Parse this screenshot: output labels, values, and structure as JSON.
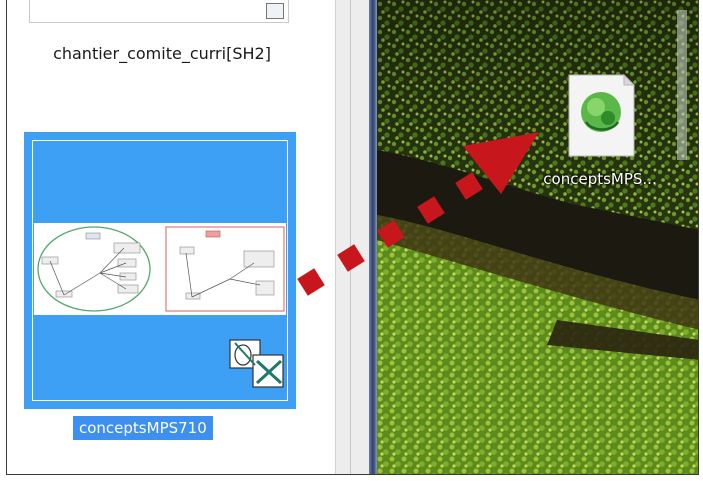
{
  "browser": {
    "previous_item_label": "chantier_comite_curri[SH2]",
    "selected_item_label": "conceptsMPS710"
  },
  "desktop": {
    "icon_label": "conceptsMPS..."
  },
  "colors": {
    "selection_blue": "#3da0f5",
    "label_highlight": "#3d8ff0",
    "arrow_red": "#c8161d",
    "desktop_green": "#4a7a1e"
  },
  "icons": {
    "desktop_file": "mindmap-file-icon",
    "overlay": "mindmap-app-icon"
  }
}
